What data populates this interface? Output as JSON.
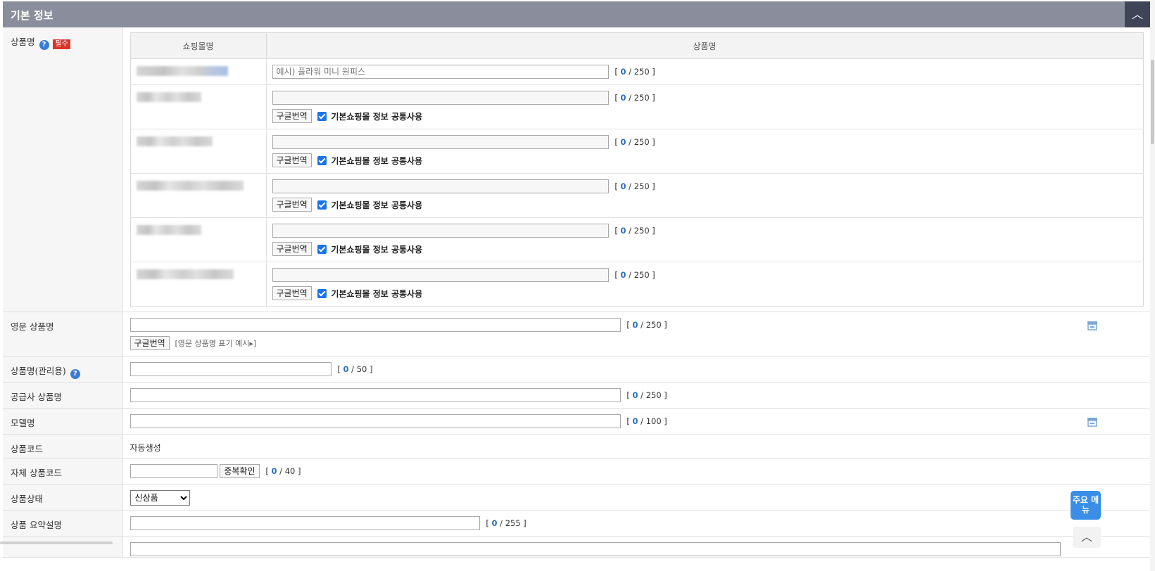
{
  "section": {
    "title": "기본 정보"
  },
  "product_name": {
    "label": "상품명",
    "required_badge": "필수",
    "col_mall": "쇼핑몰명",
    "col_name": "상품명",
    "placeholder": "예시) 플라워 미니 원피스",
    "counter_current": "0",
    "counter_max": "250",
    "translate_label": "구글번역",
    "share_label": "기본쇼핑몰 정보 공통사용",
    "mall_count": 6
  },
  "english_name": {
    "label": "영문 상품명",
    "counter_current": "0",
    "counter_max": "250",
    "translate_label": "구글번역",
    "example_link": "[영문 상품명 표기 예시▸]"
  },
  "admin_name": {
    "label": "상품명(관리용)",
    "counter_current": "0",
    "counter_max": "50"
  },
  "supplier_name": {
    "label": "공급사 상품명",
    "counter_current": "0",
    "counter_max": "250"
  },
  "model_name": {
    "label": "모델명",
    "counter_current": "0",
    "counter_max": "100"
  },
  "product_code": {
    "label": "상품코드",
    "value": "자동생성"
  },
  "custom_code": {
    "label": "자체 상품코드",
    "dup_check_label": "중복확인",
    "counter_current": "0",
    "counter_max": "40"
  },
  "product_status": {
    "label": "상품상태",
    "selected": "신상품"
  },
  "summary": {
    "label": "상품 요약설명",
    "counter_current": "0",
    "counter_max": "255"
  },
  "side": {
    "main_menu": "주요 메뉴"
  }
}
